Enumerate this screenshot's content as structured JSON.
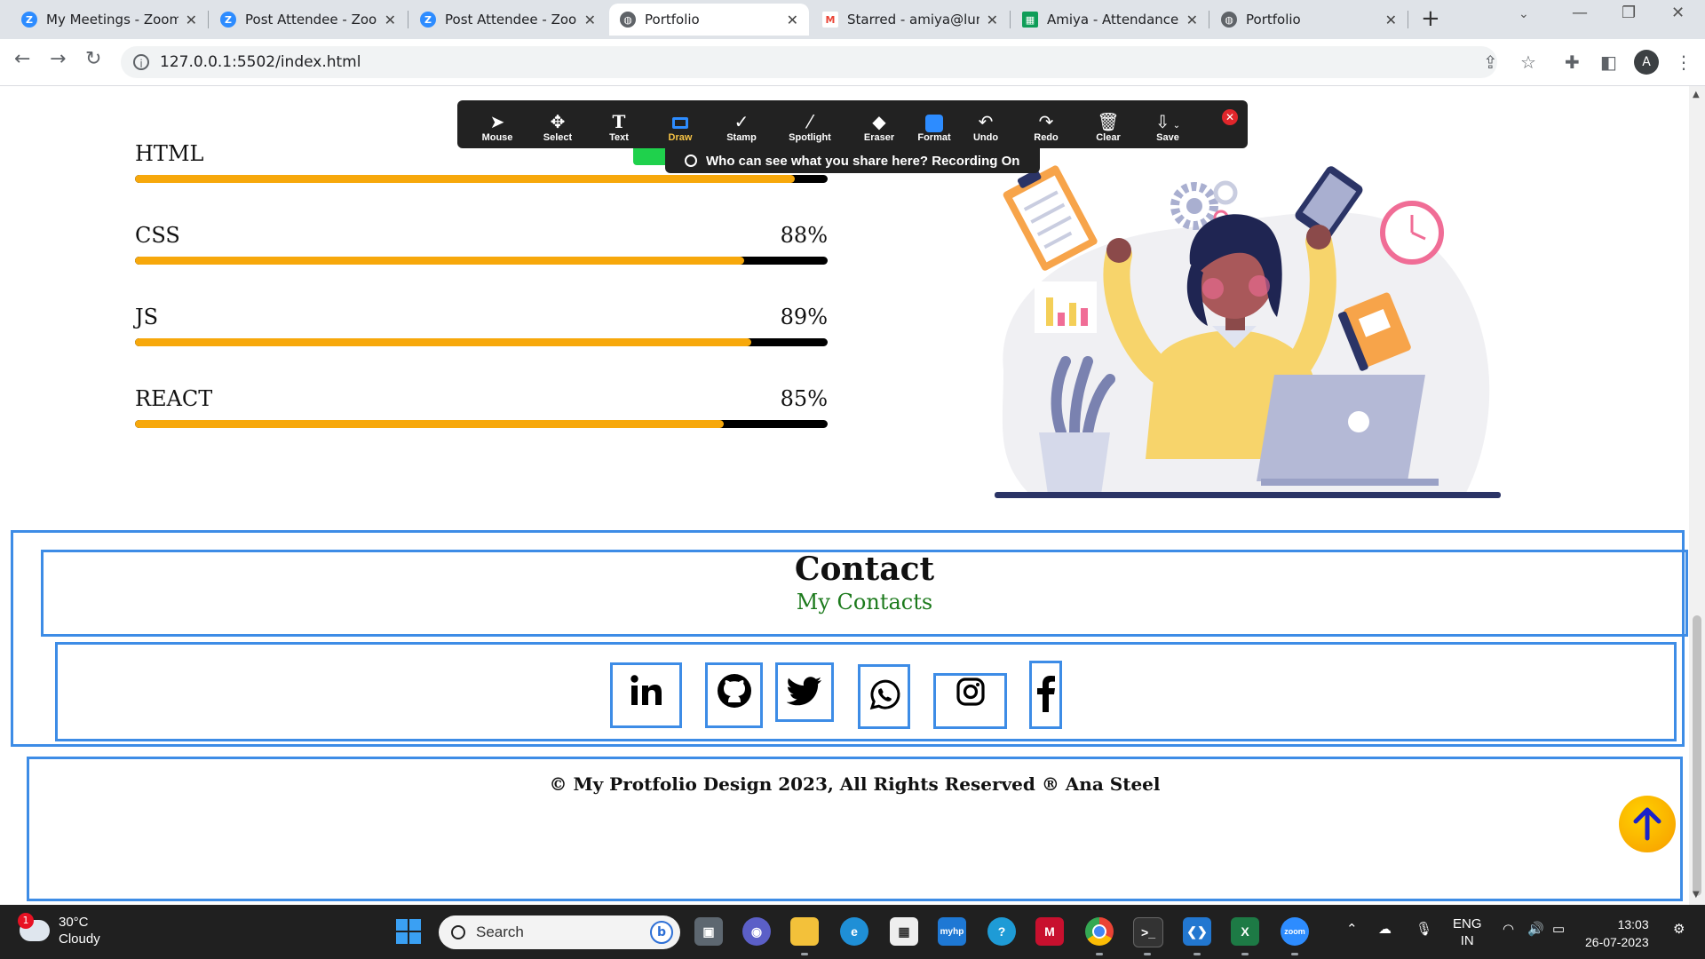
{
  "browser": {
    "tabs": [
      {
        "label": "My Meetings - Zoom",
        "icon": "zoom-icon",
        "color": "#2d8cff"
      },
      {
        "label": "Post Attendee - Zoom",
        "icon": "zoom-icon",
        "color": "#2d8cff"
      },
      {
        "label": "Post Attendee - Zoom",
        "icon": "zoom-icon",
        "color": "#2d8cff"
      },
      {
        "label": "Portfolio",
        "icon": "globe-icon",
        "color": "#5f6368",
        "active": true
      },
      {
        "label": "Starred - amiya@lum",
        "icon": "gmail-icon",
        "color": "#ea4335"
      },
      {
        "label": "Amiya - Attendance S",
        "icon": "sheets-icon",
        "color": "#0f9d58"
      },
      {
        "label": "Portfolio",
        "icon": "globe-icon",
        "color": "#5f6368"
      }
    ],
    "url": "127.0.0.1:5502/index.html",
    "profile_initial": "A"
  },
  "zoom": {
    "tools": [
      {
        "label": "Mouse",
        "icon": "cursor-icon"
      },
      {
        "label": "Select",
        "icon": "move-icon"
      },
      {
        "label": "Text",
        "icon": "text-icon"
      },
      {
        "label": "Draw",
        "icon": "rectangle-icon",
        "active": true
      },
      {
        "label": "Stamp",
        "icon": "checkmark-icon"
      },
      {
        "label": "Spotlight",
        "icon": "wand-icon"
      },
      {
        "label": "Eraser",
        "icon": "eraser-icon"
      },
      {
        "label": "Format",
        "icon": "color-swatch-icon"
      },
      {
        "label": "Undo",
        "icon": "undo-icon"
      },
      {
        "label": "Redo",
        "icon": "redo-icon"
      },
      {
        "label": "Clear",
        "icon": "trash-icon"
      },
      {
        "label": "Save",
        "icon": "save-icon"
      }
    ],
    "banner": "Who can see what you share here? Recording On",
    "accent": "#f6c345"
  },
  "skills": [
    {
      "name": "HTML",
      "percent": "",
      "fill": 0.952
    },
    {
      "name": "CSS",
      "percent": "88%",
      "fill": 0.88
    },
    {
      "name": "JS",
      "percent": "89%",
      "fill": 0.89
    },
    {
      "name": "REACT",
      "percent": "85%",
      "fill": 0.85
    }
  ],
  "contact": {
    "title": "Contact",
    "subtitle": "My Contacts",
    "socials": [
      "linkedin-icon",
      "github-icon",
      "twitter-icon",
      "whatsapp-icon",
      "instagram-icon",
      "facebook-icon"
    ]
  },
  "footer": {
    "text": "© My Protfolio Design 2023, All Rights Reserved ® Ana Steel"
  },
  "taskbar": {
    "weather_temp": "30°C",
    "weather_desc": "Cloudy",
    "weather_badge": "1",
    "search_placeholder": "Search",
    "lang_top": "ENG",
    "lang_bottom": "IN",
    "time": "13:03",
    "date": "26-07-2023"
  },
  "colors": {
    "skill_fill": "#f7a80b",
    "frame_border": "#3d8ce6",
    "subtitle_green": "#1c7a1c"
  }
}
